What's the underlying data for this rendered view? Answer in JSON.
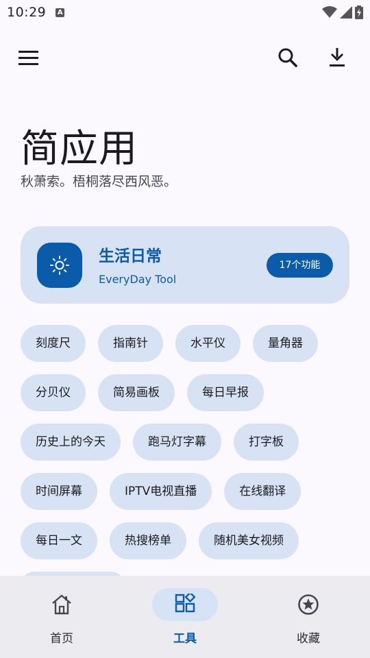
{
  "status_bar": {
    "time": "10:29",
    "notification_icon": "a-letter-icon",
    "icons": [
      "wifi-icon",
      "signal-icon",
      "battery-charging-icon"
    ]
  },
  "app_bar": {
    "menu_icon": "hamburger-menu-icon",
    "search_icon": "search-icon",
    "download_icon": "download-icon"
  },
  "hero": {
    "title": "简应用",
    "subtitle": "秋萧索。梧桐落尽西风恶。"
  },
  "category": {
    "icon": "sun-icon",
    "title": "生活日常",
    "subtitle": "EveryDay Tool",
    "badge": "17个功能"
  },
  "tools": [
    [
      "刻度尺",
      "指南针",
      "水平仪",
      "量角器"
    ],
    [
      "分贝仪",
      "简易画板",
      "每日早报"
    ],
    [
      "历史上的今天",
      "跑马灯字幕",
      "打字板"
    ],
    [
      "时间屏幕",
      "IPTV电视直播",
      "在线翻译"
    ],
    [
      "每日一文",
      "热搜榜单",
      "随机美女视频"
    ]
  ],
  "bottom_nav": {
    "items": [
      {
        "label": "首页",
        "icon": "home-icon",
        "active": false
      },
      {
        "label": "工具",
        "icon": "apps-grid-icon",
        "active": true
      },
      {
        "label": "收藏",
        "icon": "star-circle-icon",
        "active": false
      }
    ]
  },
  "colors": {
    "background": "#fbf9fe",
    "accent": "#0b5bab",
    "container": "#d8e2f5",
    "nav_background": "#ecebf0"
  }
}
